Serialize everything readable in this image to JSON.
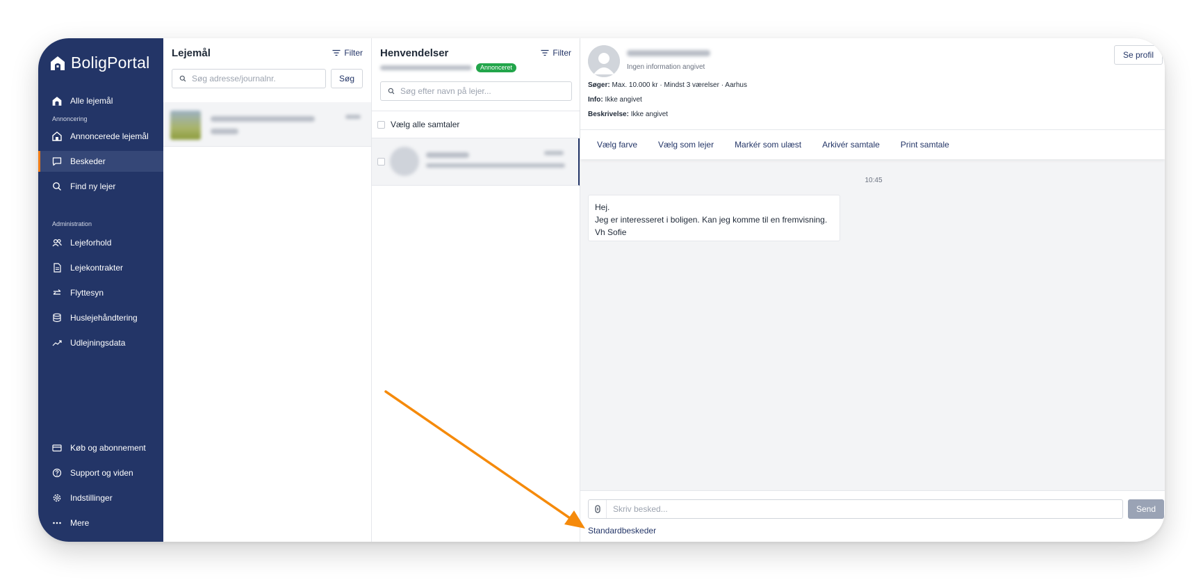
{
  "sidebar": {
    "logo": "BoligPortal",
    "all_leases": "Alle lejemål",
    "section_ads": "Annoncering",
    "items_ads": [
      {
        "label": "Annoncerede lejemål",
        "icon": "house-search-icon"
      },
      {
        "label": "Beskeder",
        "icon": "chat-icon"
      },
      {
        "label": "Find ny lejer",
        "icon": "search-icon"
      }
    ],
    "section_admin": "Administration",
    "items_admin": [
      {
        "label": "Lejeforhold",
        "icon": "people-icon"
      },
      {
        "label": "Lejekontrakter",
        "icon": "document-icon"
      },
      {
        "label": "Flyttesyn",
        "icon": "swap-arrows-icon"
      },
      {
        "label": "Huslejehåndtering",
        "icon": "database-icon"
      },
      {
        "label": "Udlejningsdata",
        "icon": "trend-icon"
      }
    ],
    "items_bottom": [
      {
        "label": "Køb og abonnement",
        "icon": "credit-card-icon"
      },
      {
        "label": "Support og viden",
        "icon": "help-icon"
      },
      {
        "label": "Indstillinger",
        "icon": "settings-icon"
      },
      {
        "label": "Mere",
        "icon": "more-dots-icon"
      }
    ],
    "active_item": "Beskeder",
    "accent_color": "#f07d18",
    "bg_color": "#233567"
  },
  "leases": {
    "title": "Lejemål",
    "filter": "Filter",
    "search_placeholder": "Søg adresse/journalnr.",
    "search_button": "Søg"
  },
  "inquiries": {
    "title": "Henvendelser",
    "filter": "Filter",
    "badge": "Annonceret",
    "search_placeholder": "Søg efter navn på lejer...",
    "select_all": "Vælg alle samtaler"
  },
  "conversation": {
    "no_info": "Ingen information angivet",
    "view_profile": "Se profil",
    "seeks_label": "Søger:",
    "seeks_value": "Max. 10.000 kr · Mindst 3 værelser · Aarhus",
    "info_label": "Info:",
    "info_value": "Ikke angivet",
    "desc_label": "Beskrivelse:",
    "desc_value": "Ikke angivet",
    "actions": [
      "Vælg farve",
      "Vælg som lejer",
      "Markér som ulæst",
      "Arkivér samtale",
      "Print samtale"
    ],
    "timestamp": "10:45",
    "message_lines": [
      "Hej.",
      "Jeg er interesseret i boligen. Kan jeg komme til en fremvisning.",
      "Vh Sofie"
    ],
    "input_placeholder": "Skriv besked...",
    "send": "Send",
    "standard_messages": "Standardbeskeder"
  },
  "annotation": {
    "arrow_color": "#f58a0b"
  }
}
